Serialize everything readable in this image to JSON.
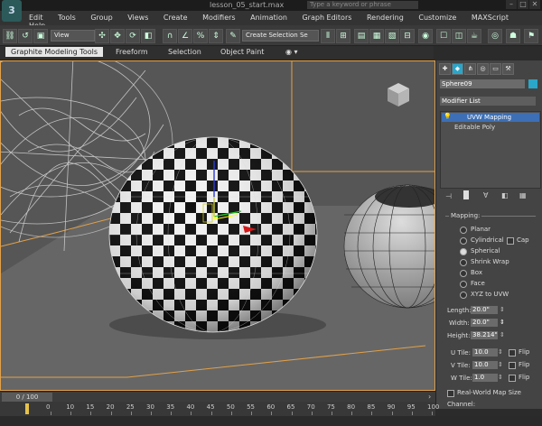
{
  "window": {
    "title": "lesson_05_start.max",
    "search_placeholder": "Type a keyword or phrase",
    "buttons": [
      "–",
      "□",
      "✕"
    ]
  },
  "menu": [
    "Edit",
    "Tools",
    "Group",
    "Views",
    "Create",
    "Modifiers",
    "Animation",
    "Graph Editors",
    "Rendering",
    "Customize",
    "MAXScript",
    "Help"
  ],
  "toolbar": {
    "view_dropdown": "View",
    "selection_set": "Create Selection Se"
  },
  "ribbon": {
    "tabs": [
      "Graphite Modeling Tools",
      "Freeform",
      "Selection",
      "Object Paint"
    ],
    "active_tab": 0
  },
  "panel": {
    "object_name": "Sphere09",
    "modifier_list_label": "Modifier List",
    "stack": [
      "UVW Mapping",
      "Editable Poly"
    ],
    "section_label": "Mapping:",
    "mapping_options": [
      "Planar",
      "Cylindrical",
      "Spherical",
      "Shrink Wrap",
      "Box",
      "Face",
      "XYZ to UVW"
    ],
    "selected_mapping": "Spherical",
    "cap_label": "Cap",
    "length_label": "Length:",
    "length": "20.0\"",
    "width_label": "Width:",
    "width": "20.0\"",
    "height_label": "Height:",
    "height": "38.214\"",
    "utile_label": "U Tile:",
    "utile": "10.0",
    "vtile_label": "V Tile:",
    "vtile": "10.0",
    "wtile_label": "W Tile:",
    "wtile": "1.0",
    "flip_label": "Flip",
    "real_world_label": "Real-World Map Size",
    "channel_label": "Channel:"
  },
  "timeline": {
    "frame_label": "0 / 100",
    "ticks": [
      "0",
      "10",
      "15",
      "20",
      "25",
      "30",
      "35",
      "40",
      "45",
      "50",
      "55",
      "60",
      "65",
      "70",
      "75",
      "80",
      "85",
      "90",
      "95",
      "100"
    ]
  },
  "colors": {
    "accent": "#2aa6c9",
    "viewport_border": "#e1a14a",
    "highlight": "#3c6fb6"
  }
}
